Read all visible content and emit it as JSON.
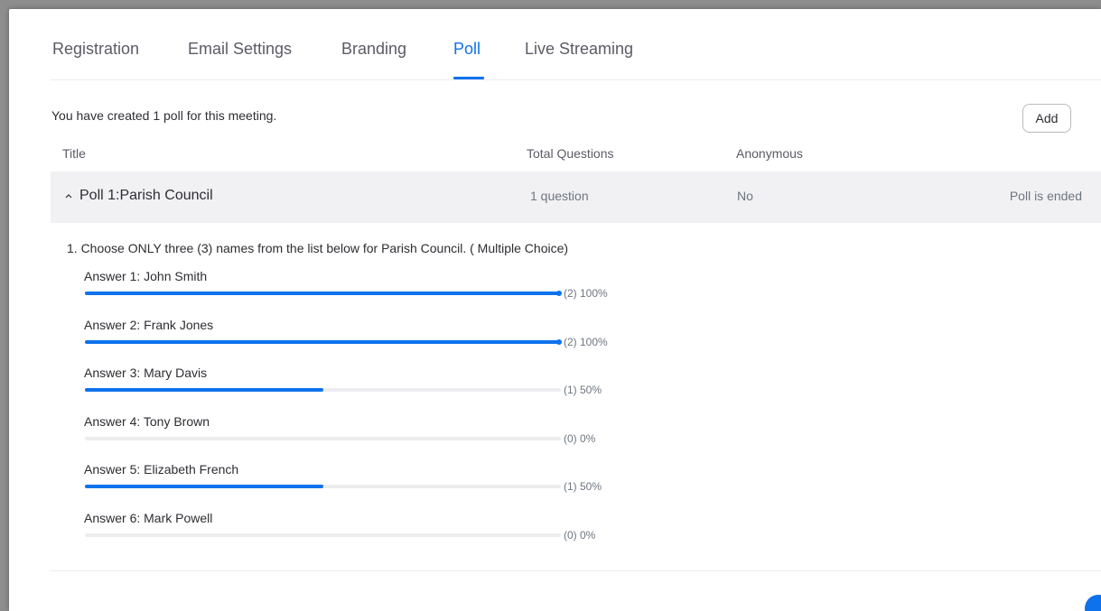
{
  "tabs": [
    {
      "label": "Registration"
    },
    {
      "label": "Email Settings"
    },
    {
      "label": "Branding"
    },
    {
      "label": "Poll",
      "active": true
    },
    {
      "label": "Live Streaming"
    }
  ],
  "summary": "You have created 1 poll for this meeting.",
  "add_button": "Add",
  "table": {
    "headers": [
      "Title",
      "Total Questions",
      "Anonymous"
    ],
    "poll": {
      "title": "Poll 1:Parish Council",
      "total_questions": "1 question",
      "anonymous": "No",
      "status": "Poll is ended"
    }
  },
  "question": "1. Choose ONLY three (3) names from the list below for Parish Council. ( Multiple Choice)",
  "answers": [
    {
      "label": "Answer 1: John Smith",
      "result": "(2) 100%",
      "percent": 100
    },
    {
      "label": "Answer 2: Frank Jones",
      "result": "(2) 100%",
      "percent": 100
    },
    {
      "label": "Answer 3: Mary Davis",
      "result": "(1) 50%",
      "percent": 50
    },
    {
      "label": "Answer 4: Tony Brown",
      "result": "(0) 0%",
      "percent": 0
    },
    {
      "label": "Answer 5: Elizabeth French",
      "result": "(1) 50%",
      "percent": 50
    },
    {
      "label": "Answer 6: Mark Powell",
      "result": "(0) 0%",
      "percent": 0
    }
  ],
  "colors": {
    "accent": "#0e72ed",
    "track": "#ededf0"
  }
}
